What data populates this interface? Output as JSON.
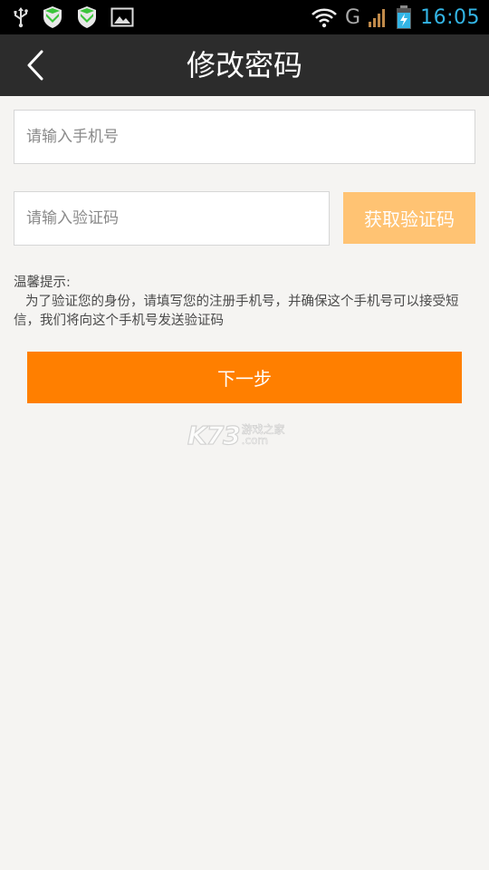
{
  "status_bar": {
    "time": "16:05",
    "network_type": "G",
    "icons": [
      "usb-icon",
      "shield-icon",
      "shield-icon",
      "image-icon",
      "wifi-icon",
      "signal-icon",
      "battery-charging-icon"
    ],
    "time_color": "#33b5e5"
  },
  "header": {
    "title": "修改密码",
    "back_icon": "chevron-left-icon",
    "background": "#2c2c2c"
  },
  "form": {
    "phone_placeholder": "请输入手机号",
    "phone_value": "",
    "code_placeholder": "请输入验证码",
    "code_value": "",
    "get_code_label": "获取验证码",
    "get_code_color": "#ffc373"
  },
  "tips": {
    "title": "温馨提示:",
    "body": "为了验证您的身份，请填写您的注册手机号，并确保这个手机号可以接受短信，我们将向这个手机号发送验证码"
  },
  "next_button": {
    "label": "下一步",
    "color": "#ff7f00"
  },
  "watermark": {
    "logo": "K73",
    "text_cn": "游戏之家",
    "text_domain": ".com"
  }
}
